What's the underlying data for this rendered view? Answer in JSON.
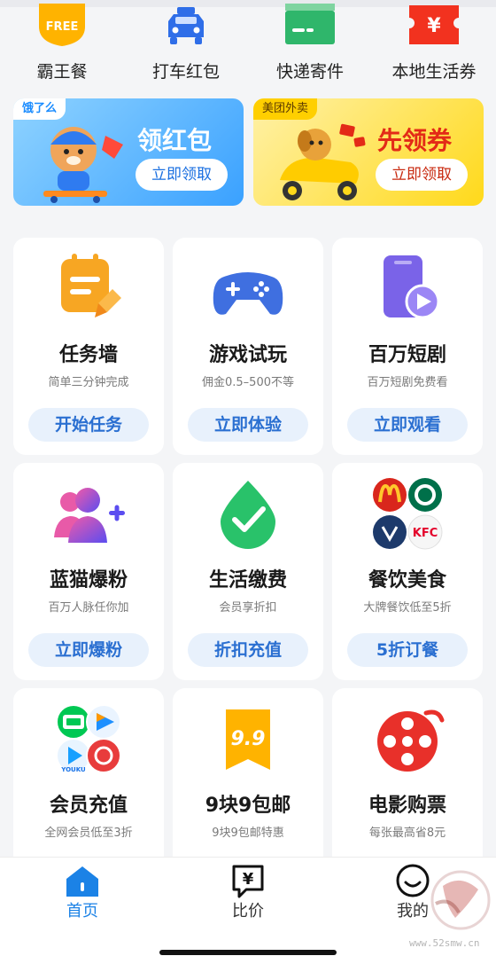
{
  "quick_nav": [
    {
      "label": "霸王餐",
      "badge": "FREE",
      "icon": "free-meal-icon"
    },
    {
      "label": "打车红包",
      "icon": "taxi-icon"
    },
    {
      "label": "快递寄件",
      "icon": "package-icon"
    },
    {
      "label": "本地生活券",
      "badge": "¥",
      "icon": "coupon-icon"
    }
  ],
  "banners": [
    {
      "tag": "饿了么",
      "title": "领红包",
      "button": "立即领取",
      "icon": "mascot-skateboard-icon"
    },
    {
      "tag": "美团外卖",
      "title": "先领券",
      "button": "立即领取",
      "icon": "mascot-scooter-icon"
    }
  ],
  "cards": [
    {
      "title": "任务墙",
      "subtitle": "简单三分钟完成",
      "button": "开始任务",
      "icon": "task-board-icon"
    },
    {
      "title": "游戏试玩",
      "subtitle": "佣金0.5–500不等",
      "button": "立即体验",
      "icon": "gamepad-icon"
    },
    {
      "title": "百万短剧",
      "subtitle": "百万短剧免费看",
      "button": "立即观看",
      "icon": "short-video-icon"
    },
    {
      "title": "蓝猫爆粉",
      "subtitle": "百万人脉任你加",
      "button": "立即爆粉",
      "icon": "add-user-icon"
    },
    {
      "title": "生活缴费",
      "subtitle": "会员享折扣",
      "button": "折扣充值",
      "icon": "checkmark-drop-icon"
    },
    {
      "title": "餐饮美食",
      "subtitle": "大牌餐饮低至5折",
      "button": "5折订餐",
      "icon": "restaurant-brands-icon",
      "brand_text": "KFC"
    },
    {
      "title": "会员充值",
      "subtitle": "全网会员低至3折",
      "button": "",
      "icon": "video-platforms-icon",
      "brand_text": "YOUKU"
    },
    {
      "title": "9块9包邮",
      "subtitle": "9块9包邮特惠",
      "button": "",
      "icon": "nine-nine-tag-icon",
      "brand_text": "9.9"
    },
    {
      "title": "电影购票",
      "subtitle": "每张最高省8元",
      "button": "",
      "icon": "film-reel-icon"
    }
  ],
  "bottom_nav": [
    {
      "label": "首页",
      "icon": "home-icon",
      "active": true
    },
    {
      "label": "比价",
      "icon": "price-compare-icon",
      "glyph": "¥",
      "active": false
    },
    {
      "label": "我的",
      "icon": "smiley-profile-icon",
      "active": false
    }
  ],
  "watermark": {
    "url": "www.52smw.cn"
  },
  "colors": {
    "accent": "#1b82e6",
    "card_button_bg": "#e8f1fc",
    "card_button_text": "#2a6fd1",
    "page_bg": "#f4f5f7"
  }
}
